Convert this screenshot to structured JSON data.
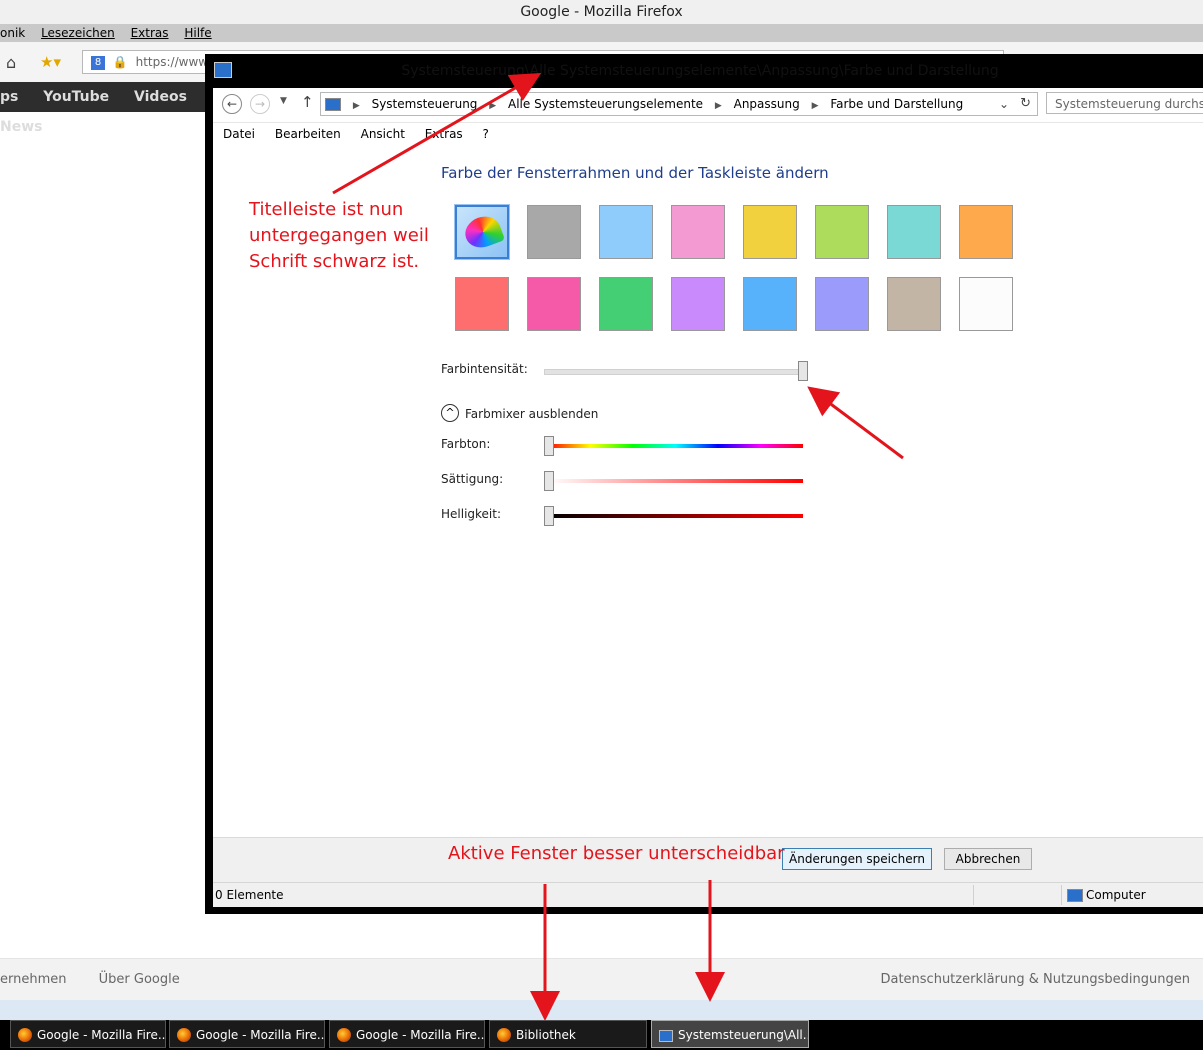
{
  "firefox": {
    "window_title": "Google - Mozilla Firefox",
    "menu": [
      "onik",
      "Lesezeichen",
      "Extras",
      "Hilfe"
    ],
    "url_text": "https://www.c",
    "google_links": [
      "ps",
      "YouTube",
      "Videos",
      "News"
    ],
    "footer_left": [
      "ernehmen",
      "Über Google"
    ],
    "footer_right": "Datenschutzerklärung & Nutzungsbedingungen"
  },
  "control_panel": {
    "window_title": "Systemsteuerung\\Alle Systemsteuerungselemente\\Anpassung\\Farbe und Darstellung",
    "breadcrumb": [
      "Systemsteuerung",
      "Alle Systemsteuerungselemente",
      "Anpassung",
      "Farbe und Darstellung"
    ],
    "search_placeholder": "Systemsteuerung durchsuch",
    "menu": [
      "Datei",
      "Bearbeiten",
      "Ansicht",
      "Extras",
      "?"
    ],
    "heading": "Farbe der Fensterrahmen und der Taskleiste ändern",
    "swatch_colors": [
      "auto",
      "#a8a8a8",
      "#8fcbfb",
      "#f39ad3",
      "#f2d13e",
      "#addb5b",
      "#7ad8d5",
      "#ffa94d",
      "#ff6e6e",
      "#f55aa8",
      "#45cf74",
      "#c98bfb",
      "#57b1fb",
      "#9b9bfb",
      "#c3b5a6",
      "#fcfcfc"
    ],
    "intensity_label": "Farbintensität:",
    "intensity_value": 1.0,
    "mixer_toggle": "Farbmixer ausblenden",
    "sliders": [
      {
        "label": "Farbton:",
        "value": 0.0
      },
      {
        "label": "Sättigung:",
        "value": 0.0
      },
      {
        "label": "Helligkeit:",
        "value": 0.0
      }
    ],
    "save_button": "Änderungen speichern",
    "cancel_button": "Abbrechen",
    "status_left": "0 Elemente",
    "status_right": "Computer"
  },
  "annotations": {
    "title_note": "Titelleiste ist nun\nuntergegangen weil\nSchrift schwarz ist.",
    "active_note": "Aktive Fenster besser unterscheidbar",
    "color": "#e3141b"
  },
  "taskbar": [
    {
      "label": "Google - Mozilla Fire...",
      "icon": "firefox-icon"
    },
    {
      "label": "Google - Mozilla Fire...",
      "icon": "firefox-icon"
    },
    {
      "label": "Google - Mozilla Fire...",
      "icon": "firefox-icon"
    },
    {
      "label": "Bibliothek",
      "icon": "firefox-icon"
    },
    {
      "label": "Systemsteuerung\\All...",
      "icon": "control-panel-icon",
      "active": true
    }
  ]
}
